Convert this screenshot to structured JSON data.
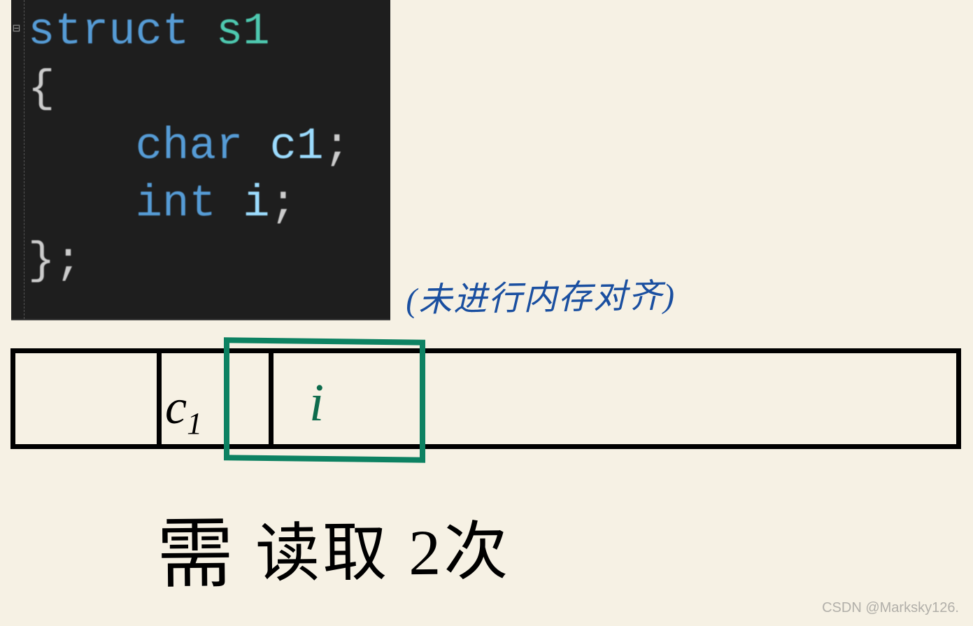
{
  "code": {
    "line1_kw": "struct",
    "line1_name": " s1",
    "line2": "{",
    "line3_type": "    char",
    "line3_var": " c1",
    "line3_semi": ";",
    "line4_type": "    int",
    "line4_var": " i",
    "line4_semi": ";",
    "line5": "};"
  },
  "annotation": {
    "no_alignment": "(未进行内存对齐)"
  },
  "memory": {
    "cell_c1": "c",
    "cell_c1_sub": "1",
    "cell_i": "i"
  },
  "bottom": {
    "text_prefix": "需",
    "text_mid": " 读取 ",
    "text_count": " 2次"
  },
  "watermark": "CSDN @Marksky126."
}
